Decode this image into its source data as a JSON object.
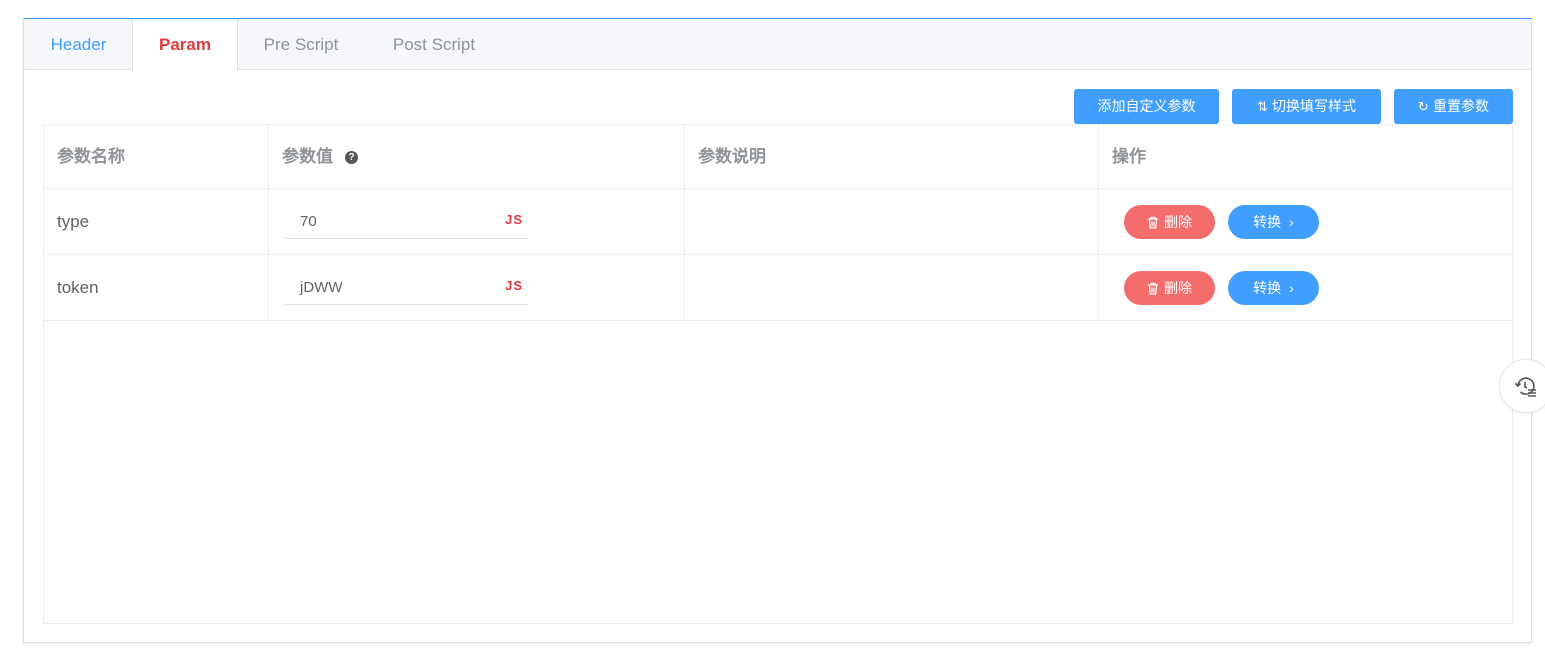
{
  "tabs": [
    {
      "label": "Header",
      "state": "link"
    },
    {
      "label": "Param",
      "state": "active"
    },
    {
      "label": "Pre Script",
      "state": "inactive"
    },
    {
      "label": "Post Script",
      "state": "inactive"
    }
  ],
  "toolbar": {
    "add_label": "添加自定义参数",
    "switch_label": "切换填写样式",
    "switch_icon": "sort-arrows-icon",
    "reset_label": "重置参数",
    "reset_icon": "refresh-icon"
  },
  "table": {
    "headers": [
      "参数名称",
      "参数值",
      "参数说明",
      "操作"
    ],
    "help_icon": "question-circle-icon",
    "rows": [
      {
        "name": "type",
        "value": "70",
        "value_tag": "JS",
        "description": "",
        "delete_label": "删除",
        "convert_label": "转换"
      },
      {
        "name": "token",
        "value": "jDWW",
        "value_tag": "JS",
        "description": "",
        "delete_label": "删除",
        "convert_label": "转换"
      }
    ]
  },
  "floating": {
    "icon": "history-list-icon"
  },
  "colors": {
    "primary": "#409eff",
    "danger": "#f56c6c",
    "active_tab": "#e0393e",
    "js_tag": "#e0393e"
  }
}
